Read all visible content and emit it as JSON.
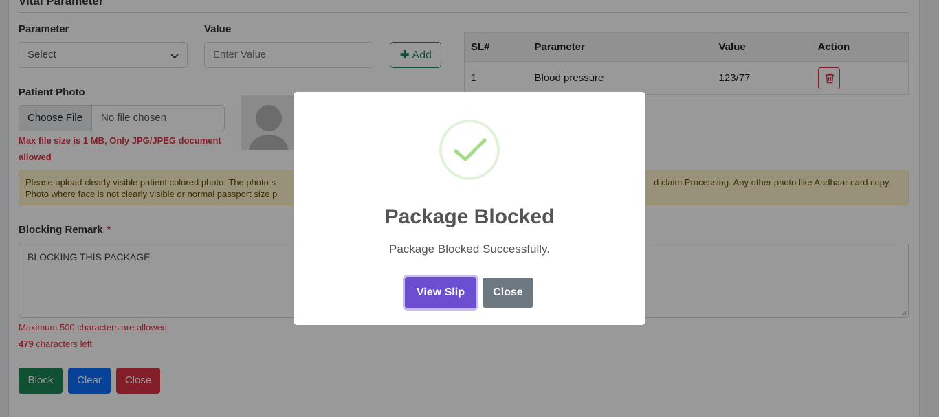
{
  "section": {
    "title": "Vital Parameter"
  },
  "vitals_form": {
    "parameter_label": "Parameter",
    "parameter_select_value": "Select",
    "value_label": "Value",
    "value_placeholder": "Enter Value",
    "add_icon": "plus-icon",
    "add_label": "Add"
  },
  "vitals_table": {
    "headers": [
      "SL#",
      "Parameter",
      "Value",
      "Action"
    ],
    "rows": [
      {
        "sl": "1",
        "parameter": "Blood pressure",
        "value": "123/77",
        "action_icon": "trash-icon"
      }
    ]
  },
  "photo": {
    "label": "Patient Photo",
    "choose_file_label": "Choose File",
    "no_file_text": "No file chosen",
    "error_line1": "Max file size is 1 MB, Only JPG/JPEG document",
    "error_line2": "allowed",
    "avatar_icon": "user-avatar-icon"
  },
  "notice": {
    "line1_left": "Please upload clearly visible patient colored photo. The photo s",
    "line1_right": "d claim Processing. Any other photo like Aadhaar card copy,",
    "line2_left": "Photo where face is not clearly visible or normal passport size p"
  },
  "remark": {
    "label": "Blocking Remark",
    "required_mark": "*",
    "value": "BLOCKING THIS PACKAGE",
    "max_note": "Maximum 500 characters are allowed.",
    "chars_left_count": "479",
    "chars_left_text": "characters left"
  },
  "actions": {
    "block_label": "Block",
    "clear_label": "Clear",
    "close_label": "Close"
  },
  "colors": {
    "success": "#198754",
    "primary": "#0d6efd",
    "danger": "#dc3545",
    "modal_confirm": "#6b4fd0",
    "modal_cancel": "#6e7881"
  },
  "modal": {
    "icon": "success-check-icon",
    "title": "Package Blocked",
    "message": "Package Blocked Successfully.",
    "view_slip_label": "View Slip",
    "close_label": "Close"
  }
}
